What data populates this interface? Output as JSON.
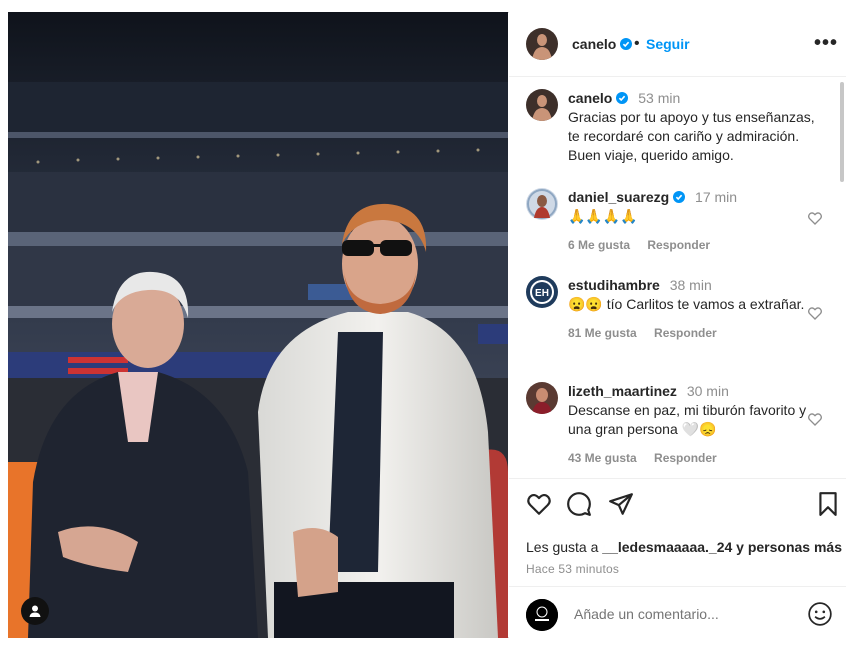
{
  "header": {
    "username": "canelo",
    "follow_label": "Seguir",
    "more_icon": "more-options-icon"
  },
  "caption": {
    "username": "canelo",
    "time": "53 min",
    "text": "Gracias por tu apoyo y tus enseñanzas, te recordaré con cariño y admiración. Buen viaje, querido amigo."
  },
  "comments": [
    {
      "username": "daniel_suarezg",
      "verified": true,
      "time": "17 min",
      "text": "🙏🙏🙏🙏",
      "likes": "6 Me gusta",
      "reply": "Responder"
    },
    {
      "username": "estudihambre",
      "verified": false,
      "time": "38 min",
      "text": "😦😦 tío Carlitos te vamos a extrañar.",
      "likes": "81 Me gusta",
      "reply": "Responder"
    },
    {
      "username": "lizeth_maartinez",
      "verified": false,
      "time": "30 min",
      "text": "Descanse en paz, mi tiburón favorito y una gran persona 🤍😞",
      "likes": "43 Me gusta",
      "reply": "Responder"
    }
  ],
  "likes": {
    "prefix": "Les gusta a ",
    "user": "__ledesmaaaaa._24",
    "suffix": " y personas más"
  },
  "posted_ago": "Hace 53 minutos",
  "add_comment": {
    "placeholder": "Añade un comentario..."
  },
  "colors": {
    "accent": "#0095f6",
    "verified": "#0095f6",
    "muted": "#8e8e8e"
  }
}
